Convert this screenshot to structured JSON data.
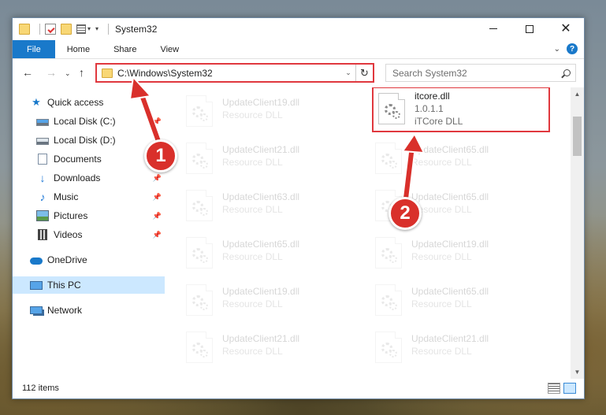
{
  "window": {
    "title": "System32"
  },
  "ribbon": {
    "tabs": [
      "File",
      "Home",
      "Share",
      "View"
    ]
  },
  "address": {
    "path": "C:\\Windows\\System32"
  },
  "search": {
    "placeholder": "Search System32"
  },
  "sidebar": {
    "items": [
      {
        "label": "Quick access",
        "icon": "star-icon"
      },
      {
        "label": "Local Disk (C:)",
        "icon": "drive-icon"
      },
      {
        "label": "Local Disk (D:)",
        "icon": "drive-icon"
      },
      {
        "label": "Documents",
        "icon": "documents-icon"
      },
      {
        "label": "Downloads",
        "icon": "downloads-icon"
      },
      {
        "label": "Music",
        "icon": "music-icon"
      },
      {
        "label": "Pictures",
        "icon": "pictures-icon"
      },
      {
        "label": "Videos",
        "icon": "videos-icon"
      },
      {
        "label": "OneDrive",
        "icon": "onedrive-icon"
      },
      {
        "label": "This PC",
        "icon": "this-pc-icon"
      },
      {
        "label": "Network",
        "icon": "network-icon"
      }
    ]
  },
  "files": {
    "left": [
      {
        "name": "UpdateClient19.dll",
        "type": "Resource DLL"
      },
      {
        "name": "UpdateClient21.dll",
        "type": "Resource DLL"
      },
      {
        "name": "UpdateClient63.dll",
        "type": "Resource DLL"
      },
      {
        "name": "UpdateClient65.dll",
        "type": "Resource DLL"
      },
      {
        "name": "UpdateClient19.dll",
        "type": "Resource DLL"
      },
      {
        "name": "UpdateClient21.dll",
        "type": "Resource DLL"
      }
    ],
    "right_highlighted": {
      "name": "itcore.dll",
      "version": "1.0.1.1",
      "description": "iTCore DLL"
    },
    "right": [
      {
        "name": "UpdateClient65.dll",
        "type": "Resource DLL"
      },
      {
        "name": "UpdateClient65.dll",
        "type": "Resource DLL"
      },
      {
        "name": "UpdateClient19.dll",
        "type": "Resource DLL"
      },
      {
        "name": "UpdateClient65.dll",
        "type": "Resource DLL"
      },
      {
        "name": "UpdateClient21.dll",
        "type": "Resource DLL"
      }
    ]
  },
  "status": {
    "item_count": "112 items"
  },
  "annotations": {
    "step1": "1",
    "step2": "2",
    "color": "#d9302b"
  }
}
